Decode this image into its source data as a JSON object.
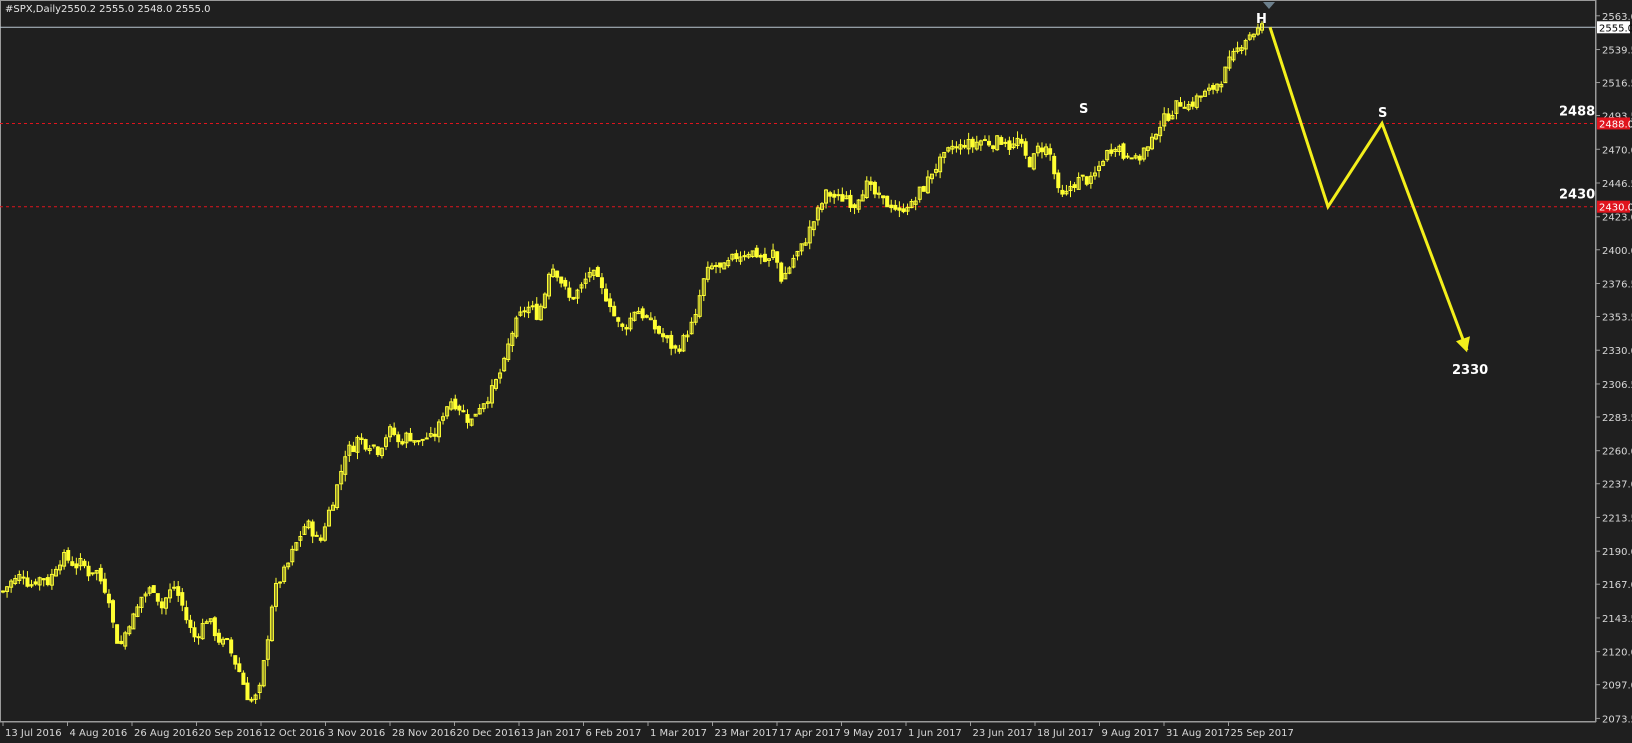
{
  "header": {
    "symbol": "#SPX,Daily",
    "ohlc": "2550.2 2555.0 2548.0 2555.0"
  },
  "colors": {
    "background": "#1f1f1f",
    "frame": "#9a9a9a",
    "candle": "#ffff33",
    "forecast": "#f3ef1b",
    "level_line": "#e0141d",
    "level_box": "#e0141d",
    "current_line": "#b9c6cf"
  },
  "chart_data": {
    "type": "candlestick",
    "ylim": [
      2071.0,
      2574.0
    ],
    "y_ticks": [
      "2563.0",
      "2539.5",
      "2516.5",
      "2493.5",
      "2470.0",
      "2446.5",
      "2423.0",
      "2400.0",
      "2376.5",
      "2353.5",
      "2330.0",
      "2306.5",
      "2283.5",
      "2260.0",
      "2237.0",
      "2213.5",
      "2190.0",
      "2167.0",
      "2143.5",
      "2120.0",
      "2097.0",
      "2073.5"
    ],
    "x_ticks": [
      "13 Jul 2016",
      "4 Aug 2016",
      "26 Aug 2016",
      "20 Sep 2016",
      "12 Oct 2016",
      "3 Nov 2016",
      "28 Nov 2016",
      "20 Dec 2016",
      "13 Jan 2017",
      "6 Feb 2017",
      "1 Mar 2017",
      "23 Mar 2017",
      "17 Apr 2017",
      "9 May 2017",
      "1 Jun 2017",
      "23 Jun 2017",
      "18 Jul 2017",
      "9 Aug 2017",
      "31 Aug 2017",
      "25 Sep 2017"
    ],
    "close_path": [
      2162,
      2168,
      2170,
      2175,
      2166,
      2170,
      2172,
      2168,
      2180,
      2186,
      2184,
      2180,
      2182,
      2175,
      2178,
      2168,
      2160,
      2130,
      2125,
      2140,
      2145,
      2158,
      2162,
      2165,
      2150,
      2160,
      2165,
      2155,
      2140,
      2130,
      2136,
      2144,
      2135,
      2126,
      2126,
      2115,
      2105,
      2090,
      2085,
      2094,
      2125,
      2160,
      2170,
      2178,
      2190,
      2200,
      2210,
      2204,
      2194,
      2212,
      2225,
      2240,
      2260,
      2262,
      2270,
      2265,
      2265,
      2260,
      2270,
      2275,
      2265,
      2270,
      2270,
      2265,
      2270,
      2268,
      2275,
      2290,
      2295,
      2292,
      2285,
      2280,
      2290,
      2295,
      2300,
      2310,
      2320,
      2340,
      2350,
      2358,
      2360,
      2355,
      2365,
      2390,
      2385,
      2375,
      2365,
      2370,
      2375,
      2385,
      2380,
      2370,
      2365,
      2350,
      2345,
      2350,
      2360,
      2355,
      2350,
      2345,
      2340,
      2335,
      2330,
      2335,
      2345,
      2350,
      2375,
      2385,
      2390,
      2385,
      2390,
      2395,
      2397,
      2399,
      2398,
      2395,
      2390,
      2400,
      2380,
      2385,
      2395,
      2400,
      2410,
      2420,
      2430,
      2440,
      2437,
      2435,
      2438,
      2430,
      2440,
      2445,
      2440,
      2435,
      2432,
      2432,
      2425,
      2433,
      2430,
      2440,
      2445,
      2455,
      2460,
      2465,
      2472,
      2470,
      2475,
      2472,
      2476,
      2476,
      2474,
      2476,
      2477,
      2470,
      2477,
      2465,
      2460,
      2470,
      2472,
      2465,
      2440,
      2435,
      2445,
      2448,
      2450,
      2447,
      2455,
      2465,
      2470,
      2475,
      2465,
      2470,
      2460,
      2470,
      2470,
      2485,
      2490,
      2495,
      2500,
      2504,
      2500,
      2505,
      2508,
      2510,
      2515,
      2520,
      2530,
      2537,
      2545,
      2550,
      2552,
      2555
    ],
    "forecast": {
      "points": [
        [
          2555.0,
          "25 Sep 2017"
        ],
        [
          2430.0,
          null
        ],
        [
          2488.0,
          null
        ],
        [
          2330.0,
          null
        ]
      ],
      "values": [
        2555.0,
        2430.0,
        2488.0,
        2330.0
      ]
    },
    "annotations": [
      {
        "text": "H"
      },
      {
        "text": "S"
      },
      {
        "text": "S"
      }
    ],
    "levels": [
      {
        "label": "2488",
        "box_label": "2488.0",
        "value": 2488.0
      },
      {
        "label": "2430",
        "box_label": "2430.0",
        "value": 2430.0
      }
    ],
    "target": {
      "label": "2330",
      "value": 2330.0
    },
    "current_price": {
      "label": "2555.0",
      "value": 2555.0
    }
  }
}
